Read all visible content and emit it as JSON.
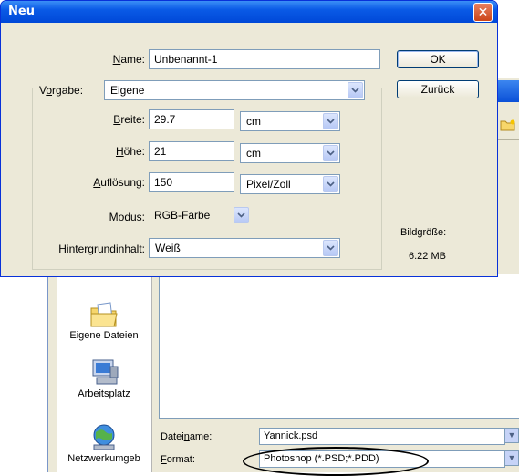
{
  "dialog": {
    "title": "Neu",
    "name_label_u": "N",
    "name_label_rest": "ame:",
    "name_value": "Unbenannt-1",
    "vorgabe_label_a": "V",
    "vorgabe_label_u": "o",
    "vorgabe_label_rest": "rgabe:",
    "vorgabe_value": "Eigene",
    "breite_label_u": "B",
    "breite_label_rest": "reite:",
    "breite_value": "29.7",
    "breite_unit": "cm",
    "hoehe_label_u": "H",
    "hoehe_label_rest": "öhe:",
    "hoehe_value": "21",
    "hoehe_unit": "cm",
    "aufl_label_u": "A",
    "aufl_label_rest": "uflösung:",
    "aufl_value": "150",
    "aufl_unit": "Pixel/Zoll",
    "modus_label_u": "M",
    "modus_label_rest": "odus:",
    "modus_value": "RGB-Farbe",
    "hg_label_a": "Hintergrund",
    "hg_label_u": "i",
    "hg_label_rest": "nhalt:",
    "hg_value": "Weiß",
    "ok_label": "OK",
    "back_label": "Zurück",
    "size_label": "Bildgröße:",
    "size_value": "6.22 MB"
  },
  "save_dialog": {
    "places": [
      "Eigene Dateien",
      "Arbeitsplatz",
      "Netzwerkumgeb"
    ],
    "filename_label_a": "Datei",
    "filename_label_u": "n",
    "filename_label_rest": "ame:",
    "filename_value": "Yannick.psd",
    "format_label_u": "F",
    "format_label_rest": "ormat:",
    "format_value": "Photoshop (*.PSD;*.PDD)"
  },
  "colors": {
    "title_bar": "#0a5ae6",
    "dialog_bg": "#ece9d8",
    "close_button": "#cc4418",
    "highlight": "#000000"
  }
}
